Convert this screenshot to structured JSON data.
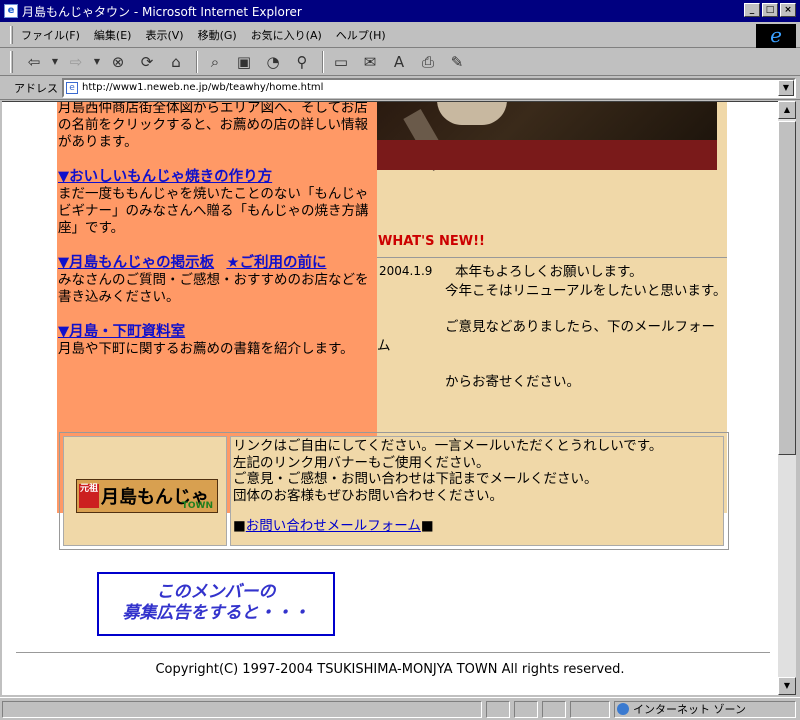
{
  "window": {
    "title": "月島もんじゃタウン - Microsoft Internet Explorer"
  },
  "menubar": {
    "items": [
      "ファイル(F)",
      "編集(E)",
      "表示(V)",
      "移動(G)",
      "お気に入り(A)",
      "ヘルプ(H)"
    ]
  },
  "address": {
    "label": "アドレス",
    "url": "http://www1.neweb.ne.jp/wb/teawhy/home.html"
  },
  "left": {
    "intro": "月島西仲商店街全体図からエリア図へ、そしてお店の名前をクリックすると、お薦めの店の詳しい情報があります。",
    "link1": "▼おいしいもんじゃ焼きの作り方",
    "text1": "まだ一度ももんじゃを焼いたことのない「もんじゃビギナー」のみなさんへ贈る「もんじゃの焼き方講座」です。",
    "link2": "▼月島もんじゃの掲示板",
    "link2b": "★ご利用の前に",
    "text2": "みなさんのご質問・ご感想・おすすめのお店などを書き込みください。",
    "link3": "▼月島・下町資料室",
    "text3": "月島や下町に関するお薦めの書籍を紹介します。"
  },
  "news": {
    "heading": "WHAT'S NEW!!",
    "date": "2004.1.9",
    "line1": "本年もよろしくお願いします。",
    "line2": "今年こそはリニューアルをしたいと思います。",
    "line3": "ご意見などありましたら、下のメールフォーム",
    "line4": "からお寄せください。"
  },
  "links": {
    "banner_text": "月島もんじゃ",
    "banner_sub": "TOWN",
    "banner_mark": "元祖",
    "l1": "リンクはご自由にしてください。一言メールいただくとうれしいです。",
    "l2": "左記のリンク用バナーもご使用ください。",
    "l3": "ご意見・ご感想・お問い合わせは下記までメールください。",
    "l4": "団体のお客様もぜひお問い合わせください。",
    "mail_prefix": "■",
    "mail_link": "お問い合わせメールフォーム",
    "mail_suffix": "■"
  },
  "ad": {
    "line1": "このメンバーの",
    "line2": "募集広告をすると・・・"
  },
  "footer": {
    "copyright": "Copyright(C) 1997-2004 TSUKISHIMA-MONJYA TOWN All rights reserved."
  },
  "status": {
    "zone": "インターネット ゾーン"
  }
}
